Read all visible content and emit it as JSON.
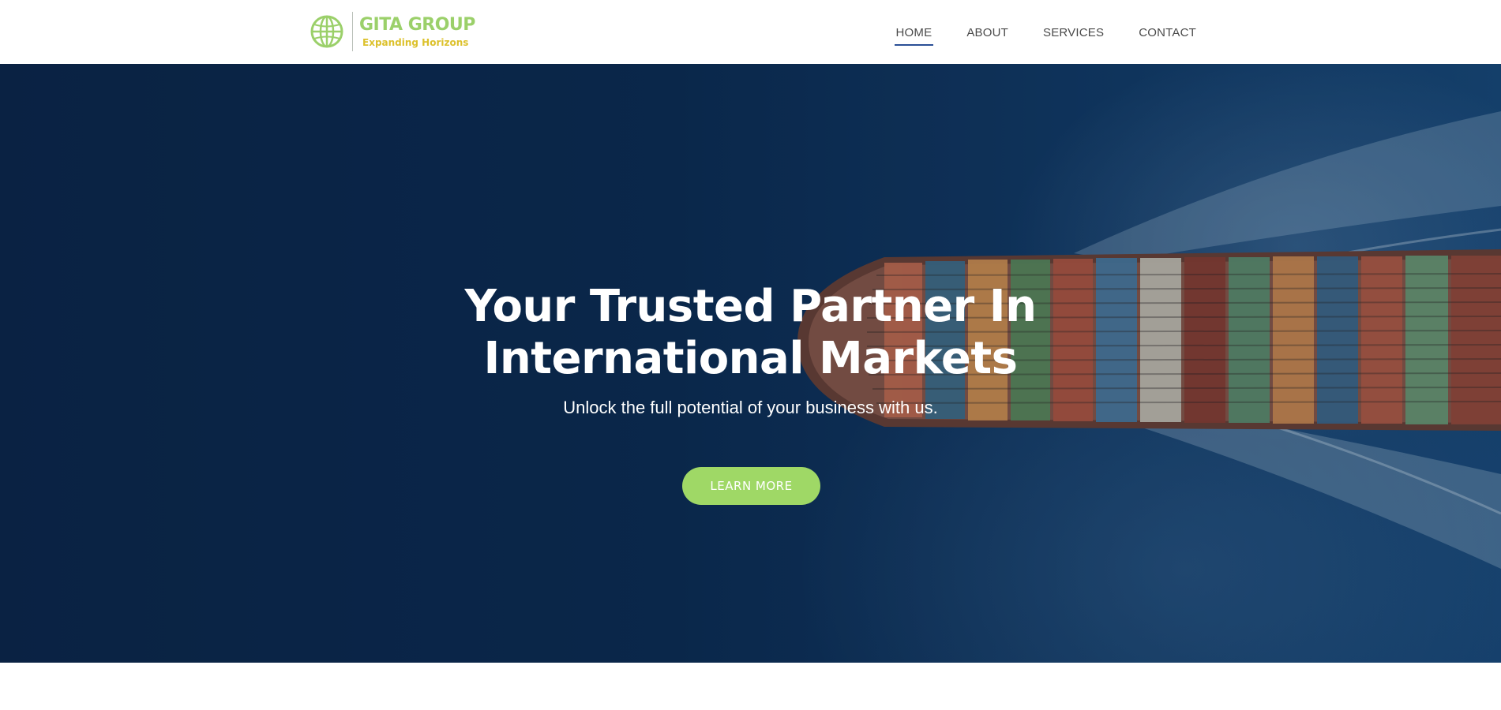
{
  "brand": {
    "name": "GITA GROUP",
    "tagline": "Expanding Horizons",
    "logo_icon": "globe-icon",
    "colors": {
      "name": "#9bd06a",
      "tagline": "#dcc12c"
    }
  },
  "nav": {
    "items": [
      {
        "label": "HOME",
        "active": true
      },
      {
        "label": "ABOUT"
      },
      {
        "label": "SERVICES"
      },
      {
        "label": "CONTACT"
      }
    ],
    "active_color": "#2a4f96"
  },
  "hero": {
    "title_line1": "Your Trusted Partner In",
    "title_line2": "International Markets",
    "subtitle": "Unlock the full potential of your business with us.",
    "cta_label": "LEARN MORE",
    "cta_color": "#9fd866",
    "background": "aerial view of container ship on ocean"
  }
}
